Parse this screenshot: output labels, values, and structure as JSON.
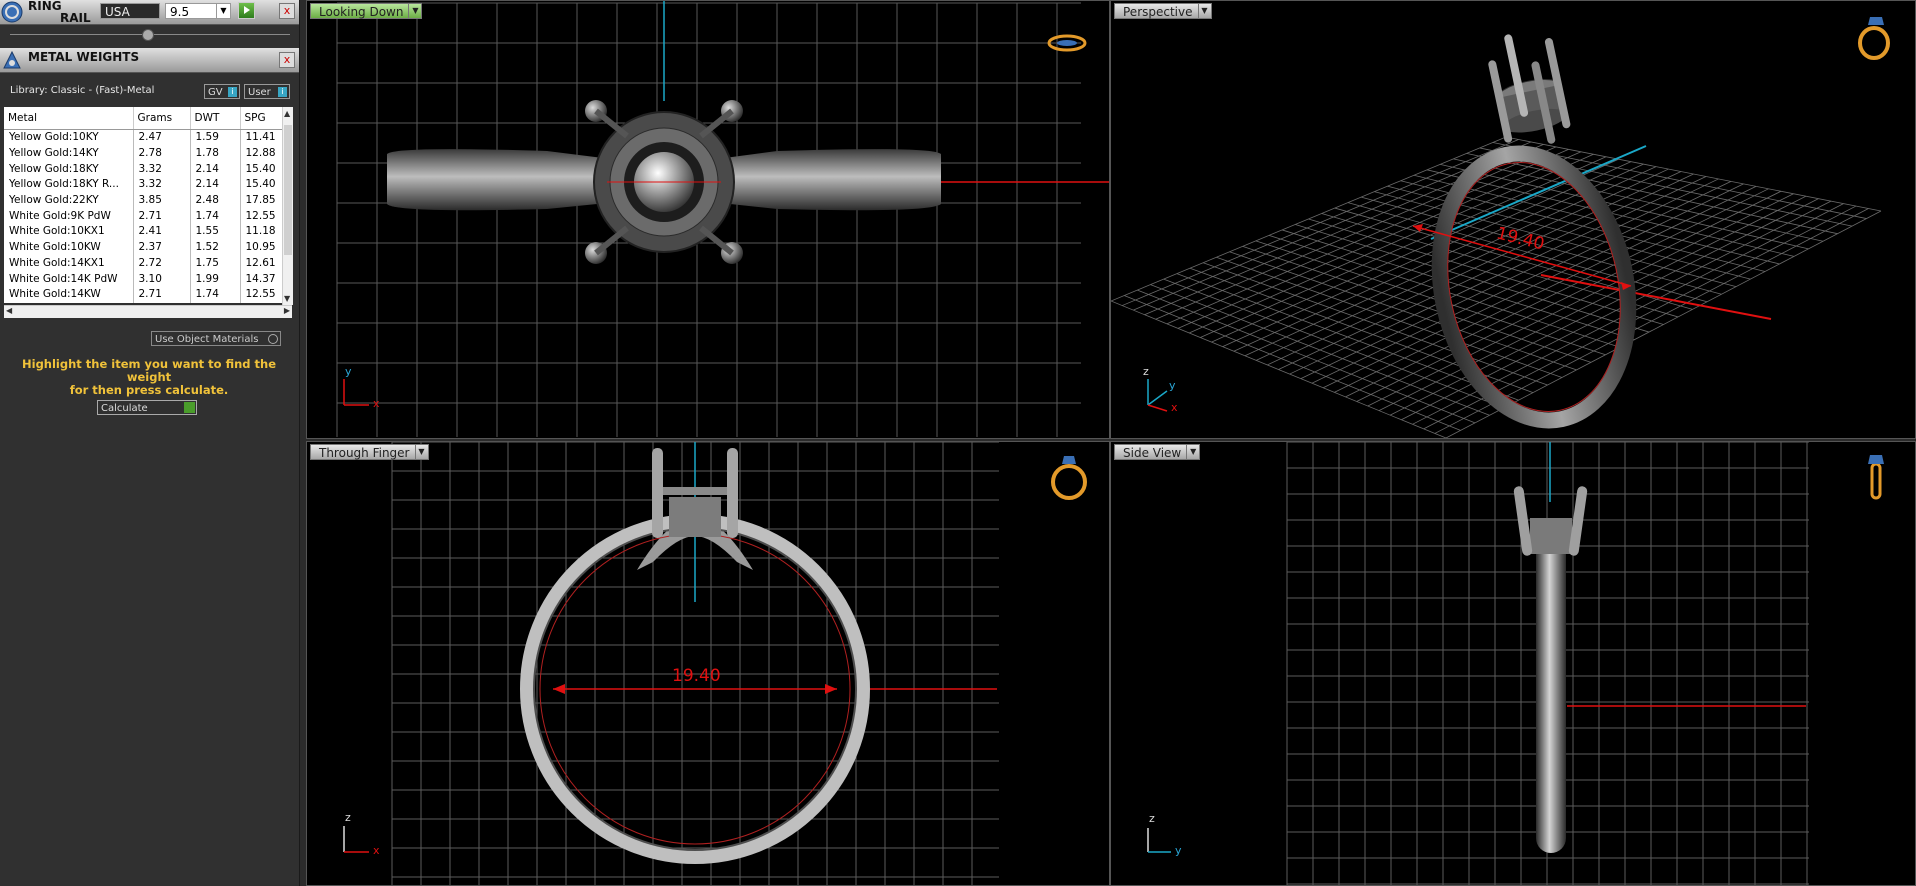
{
  "ring_rail": {
    "title_line1": "RING",
    "title_line2": "RAIL",
    "country": "USA",
    "size": "9.5",
    "close": "x"
  },
  "metal_weights": {
    "title": "METAL WEIGHTS",
    "close": "x",
    "library_label": "Library: Classic - (Fast)-Metal",
    "gv_label": "GV",
    "user_label": "User",
    "info_glyph": "i",
    "columns": [
      "Metal",
      "Grams",
      "DWT",
      "SPG"
    ],
    "rows": [
      [
        "Yellow Gold:10KY",
        "2.47",
        "1.59",
        "11.41"
      ],
      [
        "Yellow Gold:14KY",
        "2.78",
        "1.78",
        "12.88"
      ],
      [
        "Yellow Gold:18KY",
        "3.32",
        "2.14",
        "15.40"
      ],
      [
        "Yellow Gold:18KY R...",
        "3.32",
        "2.14",
        "15.40"
      ],
      [
        "Yellow Gold:22KY",
        "3.85",
        "2.48",
        "17.85"
      ],
      [
        "White Gold:9K PdW",
        "2.71",
        "1.74",
        "12.55"
      ],
      [
        "White Gold:10KX1",
        "2.41",
        "1.55",
        "11.18"
      ],
      [
        "White Gold:10KW",
        "2.37",
        "1.52",
        "10.95"
      ],
      [
        "White Gold:14KX1",
        "2.72",
        "1.75",
        "12.61"
      ],
      [
        "White Gold:14K PdW",
        "3.10",
        "1.99",
        "14.37"
      ],
      [
        "White Gold:14KW",
        "2.71",
        "1.74",
        "12.55"
      ]
    ],
    "use_object_materials": "Use Object Materials",
    "hint_line1": "Highlight the item you want to find the weight",
    "hint_line2": "for then press calculate.",
    "calculate_label": "Calculate"
  },
  "viewports": {
    "top_left": {
      "label": "Looking Down",
      "axis_v": "y",
      "axis_h": "x"
    },
    "top_right": {
      "label": "Perspective",
      "axis_v": "z",
      "axis_h": "x",
      "axis_3": "y",
      "measurement": "19.40"
    },
    "bottom_left": {
      "label": "Through Finger",
      "axis_v": "z",
      "axis_h": "x",
      "measurement": "19.40"
    },
    "bottom_right": {
      "label": "Side View",
      "axis_v": "z",
      "axis_h": "y"
    }
  },
  "colors": {
    "grid": "#5a5a5a",
    "axis_red": "#e01010",
    "axis_cyan": "#1aa8c8",
    "label_green": "#7cc44f",
    "hint_yellow": "#f0c23a",
    "nav_icon": "#e39a2a"
  },
  "icons": [
    "ring-rail-logo-icon",
    "metal-weights-icon",
    "navigation-ring-icon",
    "dropdown-arrow-icon"
  ]
}
